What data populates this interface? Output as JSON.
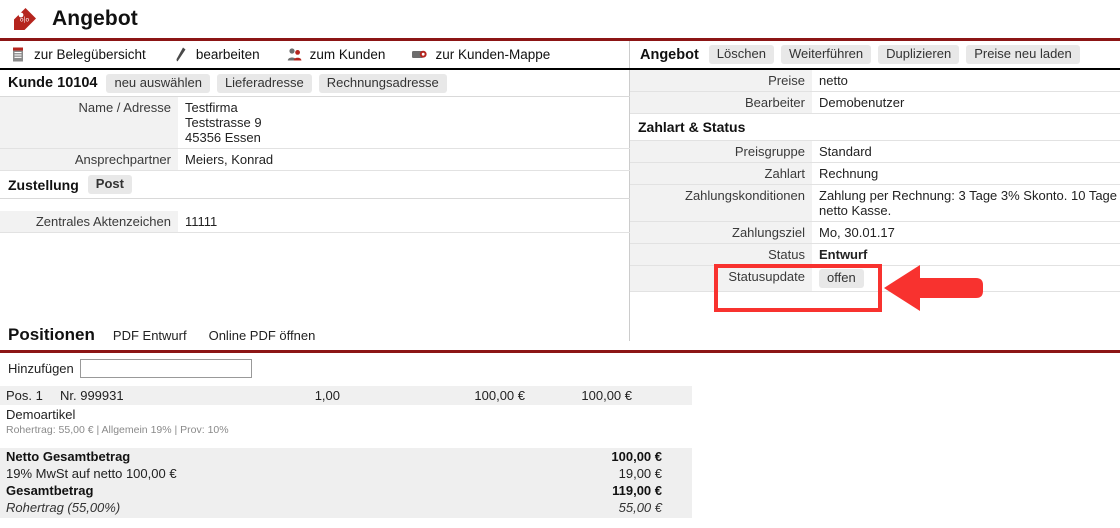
{
  "header": {
    "icon": "price-tag-icon",
    "title": "Angebot",
    "accent_color": "#8c1515"
  },
  "toolbar": {
    "items": [
      {
        "icon": "document-list-icon",
        "label": "zur Belegübersicht"
      },
      {
        "icon": "pencil-icon",
        "label": "bearbeiten"
      },
      {
        "icon": "users-icon",
        "label": "zum Kunden"
      },
      {
        "icon": "folder-camera-icon",
        "label": "zur Kunden-Mappe"
      }
    ]
  },
  "customer": {
    "label": "Kunde 10104",
    "buttons": [
      "neu auswählen",
      "Lieferadresse",
      "Rechnungsadresse"
    ],
    "fields": [
      {
        "key": "Name / Adresse",
        "value": "Testfirma\nTeststrasse 9\n45356 Essen"
      },
      {
        "key": "Ansprechpartner",
        "value": "Meiers, Konrad"
      }
    ]
  },
  "delivery": {
    "label": "Zustellung",
    "value": "Post"
  },
  "reference": {
    "fields": [
      {
        "key": "Zentrales Aktenzeichen",
        "value": "11111"
      }
    ]
  },
  "offer_panel": {
    "title": "Angebot",
    "buttons": [
      "Löschen",
      "Weiterführen",
      "Duplizieren",
      "Preise neu laden"
    ],
    "fields": [
      {
        "key": "Preise",
        "value": "netto"
      },
      {
        "key": "Bearbeiter",
        "value": "Demobenutzer"
      }
    ],
    "section_title": "Zahlart & Status",
    "payment_fields": [
      {
        "key": "Preisgruppe",
        "value": "Standard"
      },
      {
        "key": "Zahlart",
        "value": "Rechnung"
      },
      {
        "key": "Zahlungskonditionen",
        "value": "Zahlung per Rechnung: 3 Tage 3% Skonto. 10 Tage netto Kasse."
      },
      {
        "key": "Zahlungsziel",
        "value": "Mo, 30.01.17"
      }
    ],
    "status": {
      "key": "Status",
      "value": "Entwurf"
    },
    "status_update": {
      "key": "Statusupdate",
      "value": "offen"
    }
  },
  "positions": {
    "title": "Positionen",
    "links": [
      "PDF Entwurf",
      "Online PDF öffnen"
    ],
    "add_label": "Hinzufügen",
    "add_placeholder": "",
    "add_value": "",
    "rows": [
      {
        "pos": "Pos. 1",
        "nr": "Nr. 999931",
        "qty": "1,00",
        "price": "100,00 €",
        "total": "100,00 €",
        "name": "Demoartikel",
        "meta": "Rohertrag: 55,00 € | Allgemein 19% | Prov: 10%"
      }
    ]
  },
  "totals": [
    {
      "label": "Netto Gesamtbetrag",
      "value": "100,00 €",
      "style": "bold"
    },
    {
      "label": "19% MwSt auf netto 100,00 €",
      "value": "19,00 €",
      "style": "normal"
    },
    {
      "label": "Gesamtbetrag",
      "value": "119,00 €",
      "style": "bold"
    },
    {
      "label": "Rohertrag (55,00%)",
      "value": "55,00 €",
      "style": "italic"
    }
  ],
  "annotation": {
    "highlight_color": "#f8322f",
    "arrow_color": "#f8322f",
    "arrow_direction": "left",
    "target": "Status / Statusupdate"
  }
}
